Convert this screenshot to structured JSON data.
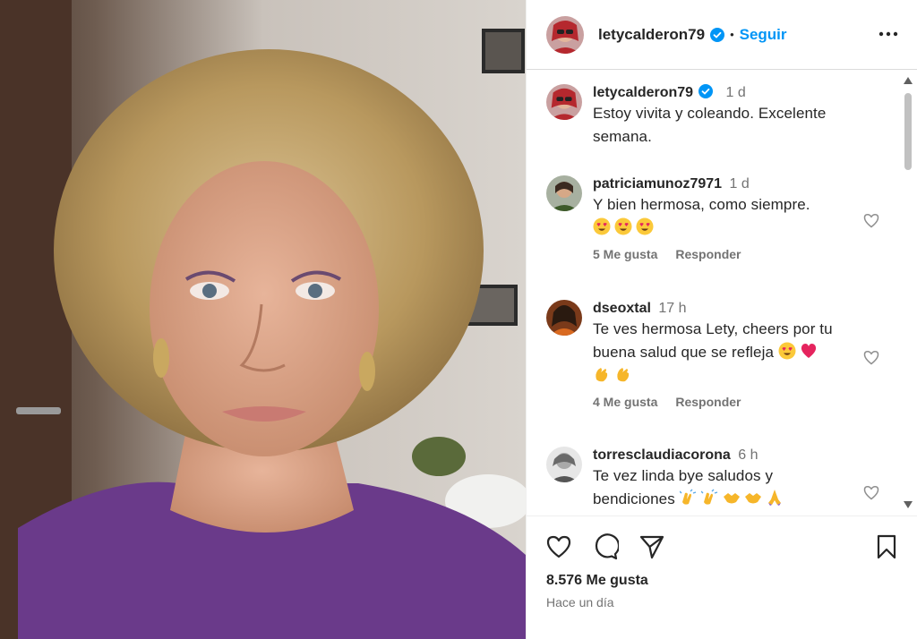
{
  "header": {
    "username": "letycalderon79",
    "separator": "•",
    "follow_label": "Seguir"
  },
  "caption": {
    "author": "letycalderon79",
    "age": "1 d",
    "text": "Estoy vivita y coleando. Excelente semana."
  },
  "comments": [
    {
      "author": "patriciamunoz7971",
      "age": "1 d",
      "text": "Y bien hermosa, como siempre.",
      "emojis": [
        "heart-eyes",
        "heart-eyes",
        "heart-eyes"
      ],
      "likes": "5 Me gusta",
      "reply": "Responder"
    },
    {
      "author": "dseoxtal",
      "age": "17 h",
      "text": "Te ves hermosa Lety, cheers por tu buena salud que se refleja",
      "emojis": [
        "heart-eyes",
        "pink-heart",
        "clapping-hands",
        "clapping-hands"
      ],
      "likes": "4 Me gusta",
      "reply": "Responder"
    },
    {
      "author": "torresclaudiacorona",
      "age": "6 h",
      "text": "Te vez linda bye saludos y bendiciones",
      "emojis": [
        "raising-hands",
        "raising-hands",
        "handshake",
        "handshake",
        "folded-hands"
      ]
    }
  ],
  "footer": {
    "likes": "8.576 Me gusta",
    "date": "Hace un día"
  },
  "colors": {
    "accent": "#0095f6",
    "text": "#262626",
    "secondary": "#737373"
  }
}
